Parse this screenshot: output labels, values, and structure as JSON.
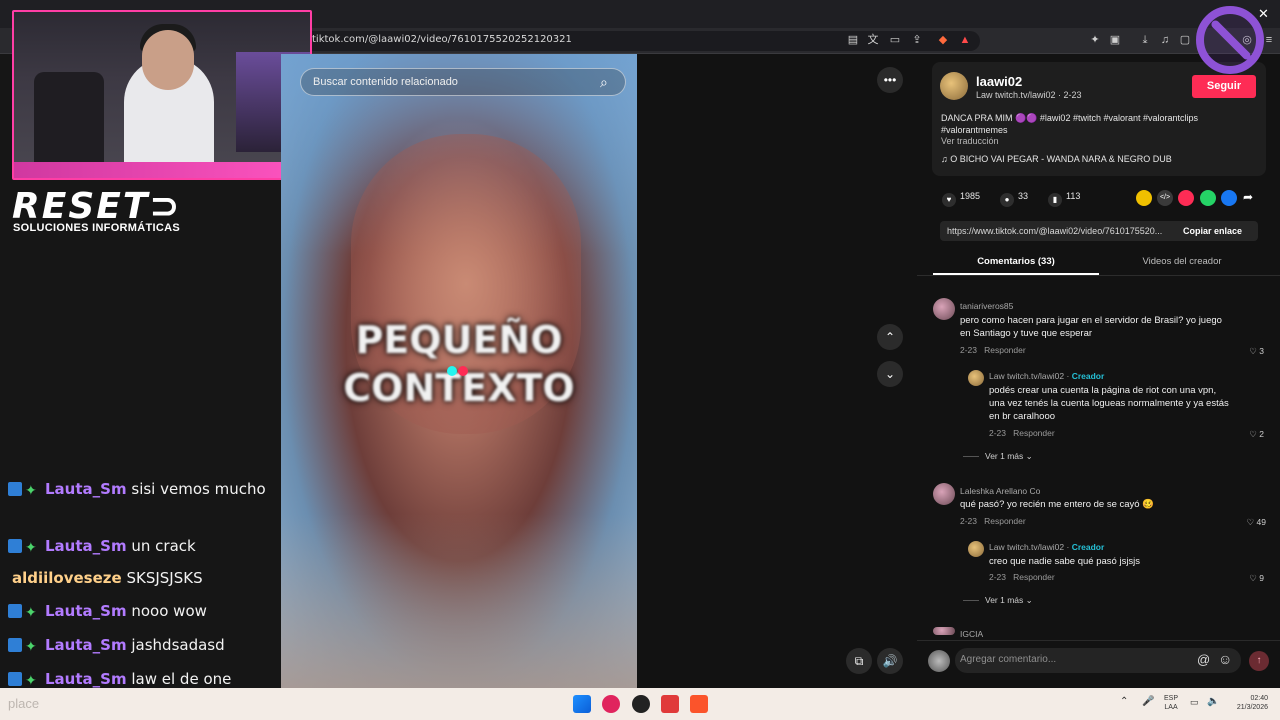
{
  "browser": {
    "url": "tiktok.com/@laawi02/video/7610175520252120321",
    "toolbar_icons": [
      "reader-icon",
      "translate-icon",
      "cast-icon",
      "share-icon",
      "shield-icon",
      "alert-icon",
      "extensions-icon",
      "sidebar-icon",
      "download-icon",
      "music-icon",
      "window-icon",
      "wallet-icon",
      "menu-icon"
    ]
  },
  "stream_overlay": {
    "logo_text": "RESET⊃",
    "logo_sub": "SOLUCIONES INFORMÁTICAS"
  },
  "chat": [
    {
      "user": "Lauta_Sm",
      "message": "sisi vemos mucho",
      "badges": true
    },
    {
      "user": "Lauta_Sm",
      "message": "un crack",
      "badges": true
    },
    {
      "user": "aldiiloveseze",
      "message": "SKSJSJSKS",
      "badges": false
    },
    {
      "user": "Lauta_Sm",
      "message": "nooo wow",
      "badges": true
    },
    {
      "user": "Lauta_Sm",
      "message": "jashdsadasd",
      "badges": true
    },
    {
      "user": "Lauta_Sm",
      "message": "law el de one",
      "badges": true
    }
  ],
  "video": {
    "search_placeholder": "Buscar contenido relacionado",
    "caption_line1": "PEQUEÑO",
    "caption_line2": "CONTEXTO"
  },
  "post": {
    "username": "laawi02",
    "meta": "Law twitch.tv/lawi02 · 2-23",
    "follow_label": "Seguir",
    "description": "DANCA PRA MIM 🟣🟣 #lawi02 #twitch #valorant #valorantclips #valorantmemes",
    "translate_label": "Ver traducción",
    "music": "O BICHO VAI PEGAR - WANDA NARA & NEGRO DUB",
    "likes": "1985",
    "comments": "33",
    "saves": "113",
    "link": "https://www.tiktok.com/@laawi02/video/7610175520...",
    "copy_label": "Copiar enlace"
  },
  "tabs": {
    "comments": "Comentarios (33)",
    "videos": "Videos del creador"
  },
  "comments": [
    {
      "author": "taniariveros85",
      "text": "pero como hacen para jugar en el servidor de Brasil? yo juego en Santiago y tuve que esperar",
      "date": "2-23",
      "reply": "Responder",
      "likes": "3",
      "replies": [
        {
          "author": "Law twitch.tv/lawi02",
          "creator": "Creador",
          "text": "podés crear una cuenta la página de riot con una vpn, una vez tenés la cuenta logueas normalmente y ya estás en br caralhooo",
          "date": "2-23",
          "reply": "Responder",
          "likes": "2"
        }
      ],
      "more": "Ver 1 más"
    },
    {
      "author": "Laleshka Arellano Co",
      "text": "qué pasó? yo recién me entero de se cayó 🥴",
      "date": "2-23",
      "reply": "Responder",
      "likes": "49",
      "replies": [
        {
          "author": "Law twitch.tv/lawi02",
          "creator": "Creador",
          "text": "creo que nadie sabe qué pasó jsjsjs",
          "date": "2-23",
          "reply": "Responder",
          "likes": "9"
        }
      ],
      "more": "Ver 1 más"
    }
  ],
  "next_comment_author": "IGCIA",
  "comment_input_placeholder": "Agregar comentario...",
  "taskbar": {
    "search_text": "place",
    "lang_line1": "ESP",
    "lang_line2": "LAA",
    "time": "02:40",
    "date": "21/3/2026"
  },
  "colors": {
    "accent": "#fe2c55",
    "creator": "#25c0d6",
    "webcam_border": "#ff3ea5",
    "chat_user": "#b27bff"
  }
}
